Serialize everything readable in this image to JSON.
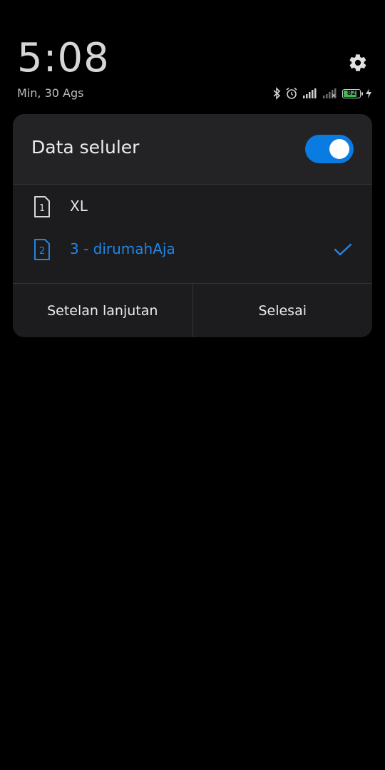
{
  "status_bar": {
    "time": "5:08",
    "date": "Min, 30 Ags",
    "battery_level": "82",
    "battery_fraction": 0.82,
    "icons": [
      "bluetooth-icon",
      "alarm-icon",
      "signal-icon",
      "signal-weak-icon",
      "battery-icon",
      "charging-icon"
    ]
  },
  "settings_icon": "gear-icon",
  "panel": {
    "title": "Data seluler",
    "toggle_on": true,
    "sims": [
      {
        "slot": "1",
        "label": "XL",
        "selected": false
      },
      {
        "slot": "2",
        "label": "3 - dirumahAja",
        "selected": true
      }
    ],
    "actions": {
      "advanced_label": "Setelan lanjutan",
      "done_label": "Selesai"
    }
  },
  "colors": {
    "accent": "#0a7be0",
    "selected_text": "#1f86e8",
    "panel_bg": "#1c1c1e",
    "battery_fill": "#3fb950"
  }
}
